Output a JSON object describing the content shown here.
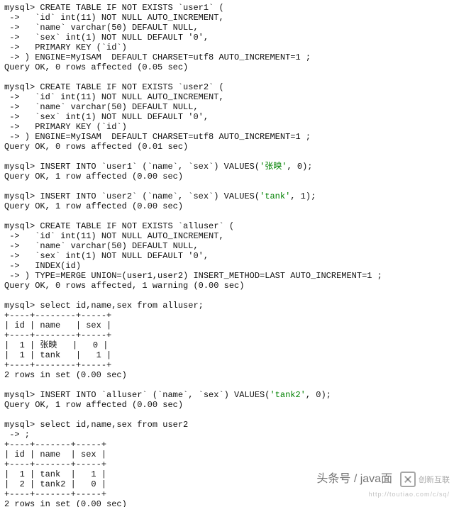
{
  "blocks": {
    "user1_create": [
      "mysql> CREATE TABLE IF NOT EXISTS `user1` (",
      " ->   `id` int(11) NOT NULL AUTO_INCREMENT,",
      " ->   `name` varchar(50) DEFAULT NULL,",
      " ->   `sex` int(1) NOT NULL DEFAULT '0',",
      " ->   PRIMARY KEY (`id`)",
      " -> ) ENGINE=MyISAM  DEFAULT CHARSET=utf8 AUTO_INCREMENT=1 ;",
      "Query OK, 0 rows affected (0.05 sec)"
    ],
    "user2_create": [
      "mysql> CREATE TABLE IF NOT EXISTS `user2` (",
      " ->   `id` int(11) NOT NULL AUTO_INCREMENT,",
      " ->   `name` varchar(50) DEFAULT NULL,",
      " ->   `sex` int(1) NOT NULL DEFAULT '0',",
      " ->   PRIMARY KEY (`id`)",
      " -> ) ENGINE=MyISAM  DEFAULT CHARSET=utf8 AUTO_INCREMENT=1 ;",
      "Query OK, 0 rows affected (0.01 sec)"
    ],
    "insert_user1_pre": "mysql> INSERT INTO `user1` (`name`, `sex`) VALUES(",
    "insert_user1_str": "'张映'",
    "insert_user1_post": ", 0);",
    "insert_user1_result": "Query OK, 1 row affected (0.00 sec)",
    "insert_user2_pre": "mysql> INSERT INTO `user2` (`name`, `sex`) VALUES(",
    "insert_user2_str": "'tank'",
    "insert_user2_post": ", 1);",
    "insert_user2_result": "Query OK, 1 row affected (0.00 sec)",
    "alluser_create": [
      "mysql> CREATE TABLE IF NOT EXISTS `alluser` (",
      " ->   `id` int(11) NOT NULL AUTO_INCREMENT,",
      " ->   `name` varchar(50) DEFAULT NULL,",
      " ->   `sex` int(1) NOT NULL DEFAULT '0',",
      " ->   INDEX(id)",
      " -> ) TYPE=MERGE UNION=(user1,user2) INSERT_METHOD=LAST AUTO_INCREMENT=1 ;",
      "Query OK, 0 rows affected, 1 warning (0.00 sec)"
    ],
    "select_alluser": "mysql> select id,name,sex from alluser;",
    "table1": [
      "+----+--------+-----+",
      "| id | name   | sex |",
      "+----+--------+-----+",
      "|  1 | 张映   |   0 |",
      "|  1 | tank   |   1 |",
      "+----+--------+-----+"
    ],
    "table1_footer": "2 rows in set (0.00 sec)",
    "insert_alluser_pre": "mysql> INSERT INTO `alluser` (`name`, `sex`) VALUES(",
    "insert_alluser_str": "'tank2'",
    "insert_alluser_post": ", 0);",
    "insert_alluser_result": "Query OK, 1 row affected (0.00 sec)",
    "select_user2_l1": "mysql> select id,name,sex from user2",
    "select_user2_l2": " -> ;",
    "table2": [
      "+----+-------+-----+",
      "| id | name  | sex |",
      "+----+-------+-----+",
      "|  1 | tank  |   1 |",
      "|  2 | tank2 |   0 |",
      "+----+-------+-----+"
    ],
    "table2_footer": "2 rows in set (0.00 sec)"
  },
  "watermark": {
    "main": "头条号 / java面",
    "sub": "http://toutiao.com/c/sq/",
    "brand": "创新互联"
  }
}
